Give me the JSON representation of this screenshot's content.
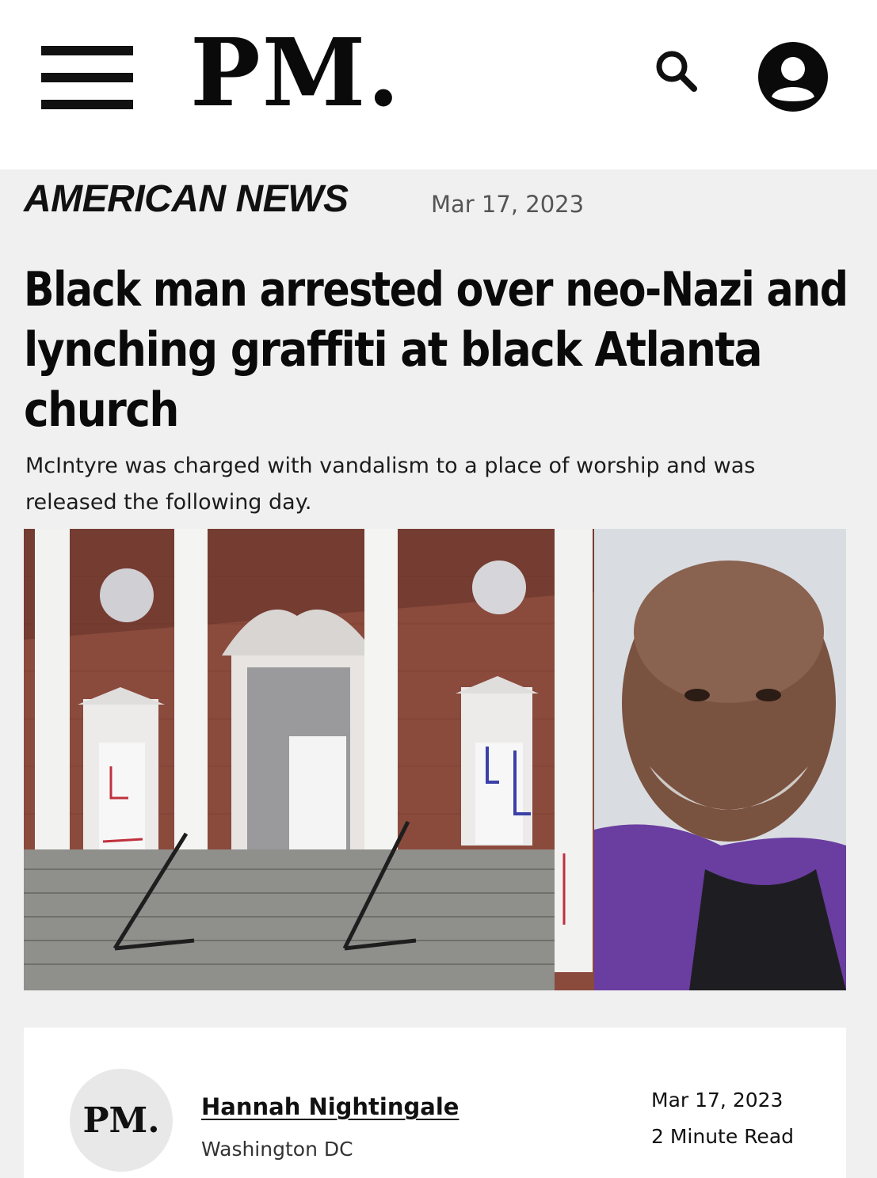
{
  "header": {
    "logo": "PM.",
    "menu_icon": "hamburger-menu-icon",
    "search_icon": "search-icon",
    "account_icon": "user-account-icon"
  },
  "article": {
    "category": "AMERICAN NEWS",
    "date": "Mar 17, 2023",
    "headline_lines": [
      "Black man arrested over neo-Nazi and",
      "lynching graffiti at black Atlanta",
      "church"
    ],
    "subhead_lines": [
      "McIntyre was charged with vandalism to a place of worship and was",
      "released the following day."
    ]
  },
  "author_card": {
    "avatar_text": "PM.",
    "name": "Hannah Nightingale",
    "location": "Washington DC",
    "date": "Mar 17, 2023",
    "read_time": "2 Minute Read"
  },
  "colors": {
    "header_bg": "#ffffff",
    "page_bg": "#f0f0f0",
    "text": "#111111",
    "muted": "#555555"
  }
}
